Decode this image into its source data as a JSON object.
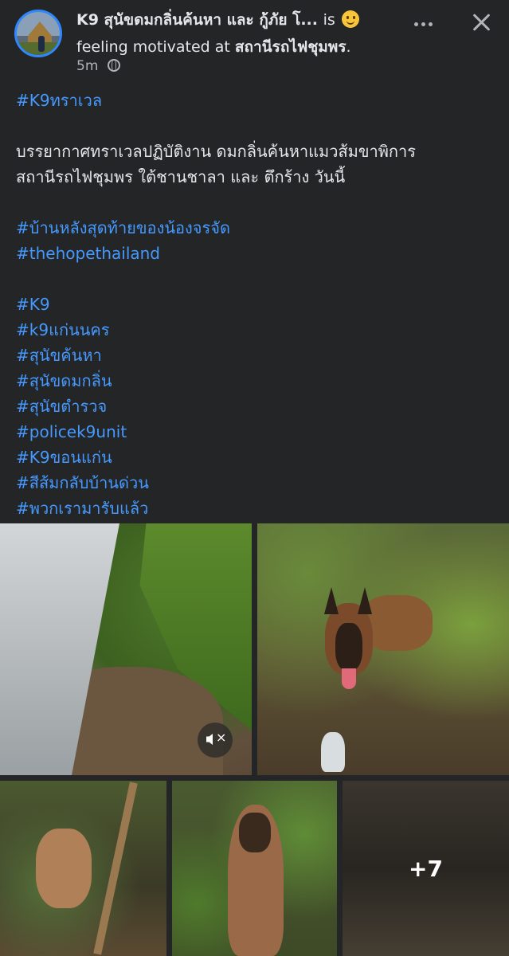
{
  "header": {
    "page_name": "K9 สุนัขดมกลิ่นค้นหา และ กู้ภัย โ...",
    "is_text": "is",
    "feeling_text": "feeling motivated at",
    "location": "สถานีรถไฟชุมพร",
    "location_suffix": ".",
    "time": "5m",
    "privacy_icon": "globe-icon",
    "more_icon": "more-dots-icon",
    "close_icon": "close-icon"
  },
  "post": {
    "tag_top": "#K9ทราเวล",
    "body_line1": "บรรยากาศทราเวลปฏิบัติงาน ดมกลิ่นค้นหาแมวส้มขาพิการ",
    "body_line2": "สถานีรถไฟชุมพร ใต้ชานชาลา และ ตึกร้าง วันนี้",
    "tags_group1": [
      "#บ้านหลังสุดท้ายของน้องจรจัด",
      "#thehopethailand"
    ],
    "tags_group2": [
      "#K9",
      "#k9แก่นนคร",
      "#สุนัขค้นหา",
      "#สุนัขดมกลิ่น",
      "#สุนัขตำรวจ",
      "#policek9unit",
      "#K9ขอนแก่น",
      "#สีส้มกลับบ้านด่วน",
      "#พวกเรามารับแล้ว"
    ]
  },
  "gallery": {
    "more_count": "+7",
    "mute_icon": "mute-icon"
  }
}
